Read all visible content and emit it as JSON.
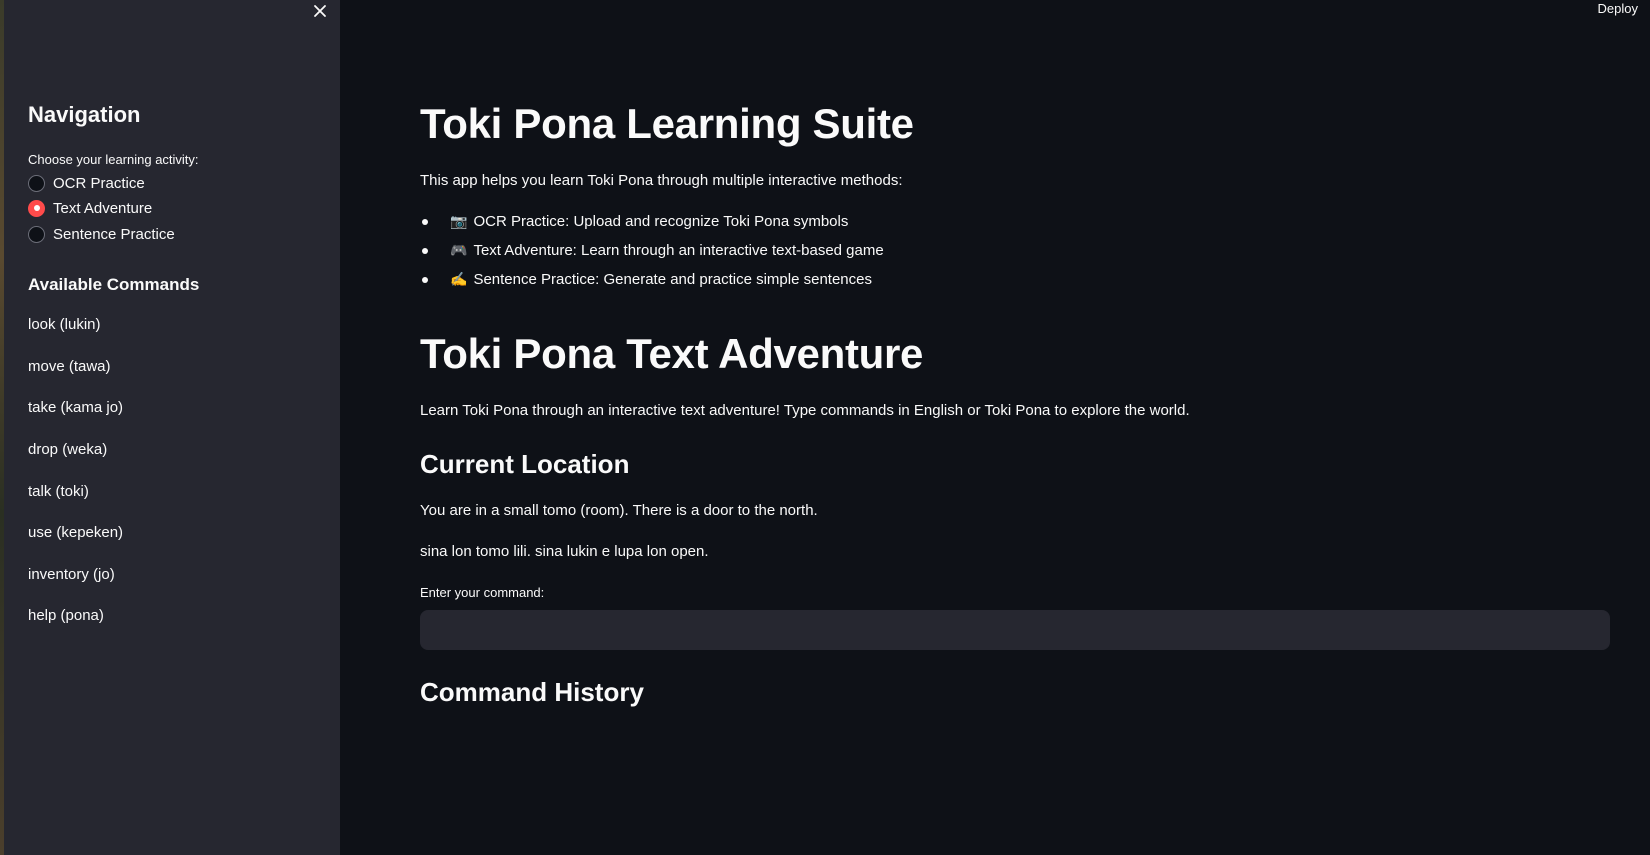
{
  "sidebar": {
    "nav_title": "Navigation",
    "radio_label": "Choose your learning activity:",
    "options": [
      {
        "label": "OCR Practice",
        "selected": false
      },
      {
        "label": "Text Adventure",
        "selected": true
      },
      {
        "label": "Sentence Practice",
        "selected": false
      }
    ],
    "commands_title": "Available Commands",
    "commands": [
      "look (lukin)",
      "move (tawa)",
      "take (kama jo)",
      "drop (weka)",
      "talk (toki)",
      "use (kepeken)",
      "inventory (jo)",
      "help (pona)"
    ]
  },
  "header": {
    "deploy_label": "Deploy"
  },
  "main": {
    "title": "Toki Pona Learning Suite",
    "intro": "This app helps you learn Toki Pona through multiple interactive methods:",
    "features": [
      {
        "icon": "📷",
        "text": "OCR Practice: Upload and recognize Toki Pona symbols"
      },
      {
        "icon": "🎮",
        "text": "Text Adventure: Learn through an interactive text-based game"
      },
      {
        "icon": "✍️",
        "text": "Sentence Practice: Generate and practice simple sentences"
      }
    ],
    "adventure_title": "Toki Pona Text Adventure",
    "adventure_intro": "Learn Toki Pona through an interactive text adventure! Type commands in English or Toki Pona to explore the world.",
    "location_title": "Current Location",
    "location_en": "You are in a small tomo (room). There is a door to the north.",
    "location_tp": "sina lon tomo lili. sina lukin e lupa lon open.",
    "command_label": "Enter your command:",
    "command_value": "",
    "history_title": "Command History"
  },
  "colors": {
    "background": "#0e1117",
    "sidebar": "#262730",
    "accent": "#ff4b4b",
    "text": "#fafafa"
  }
}
